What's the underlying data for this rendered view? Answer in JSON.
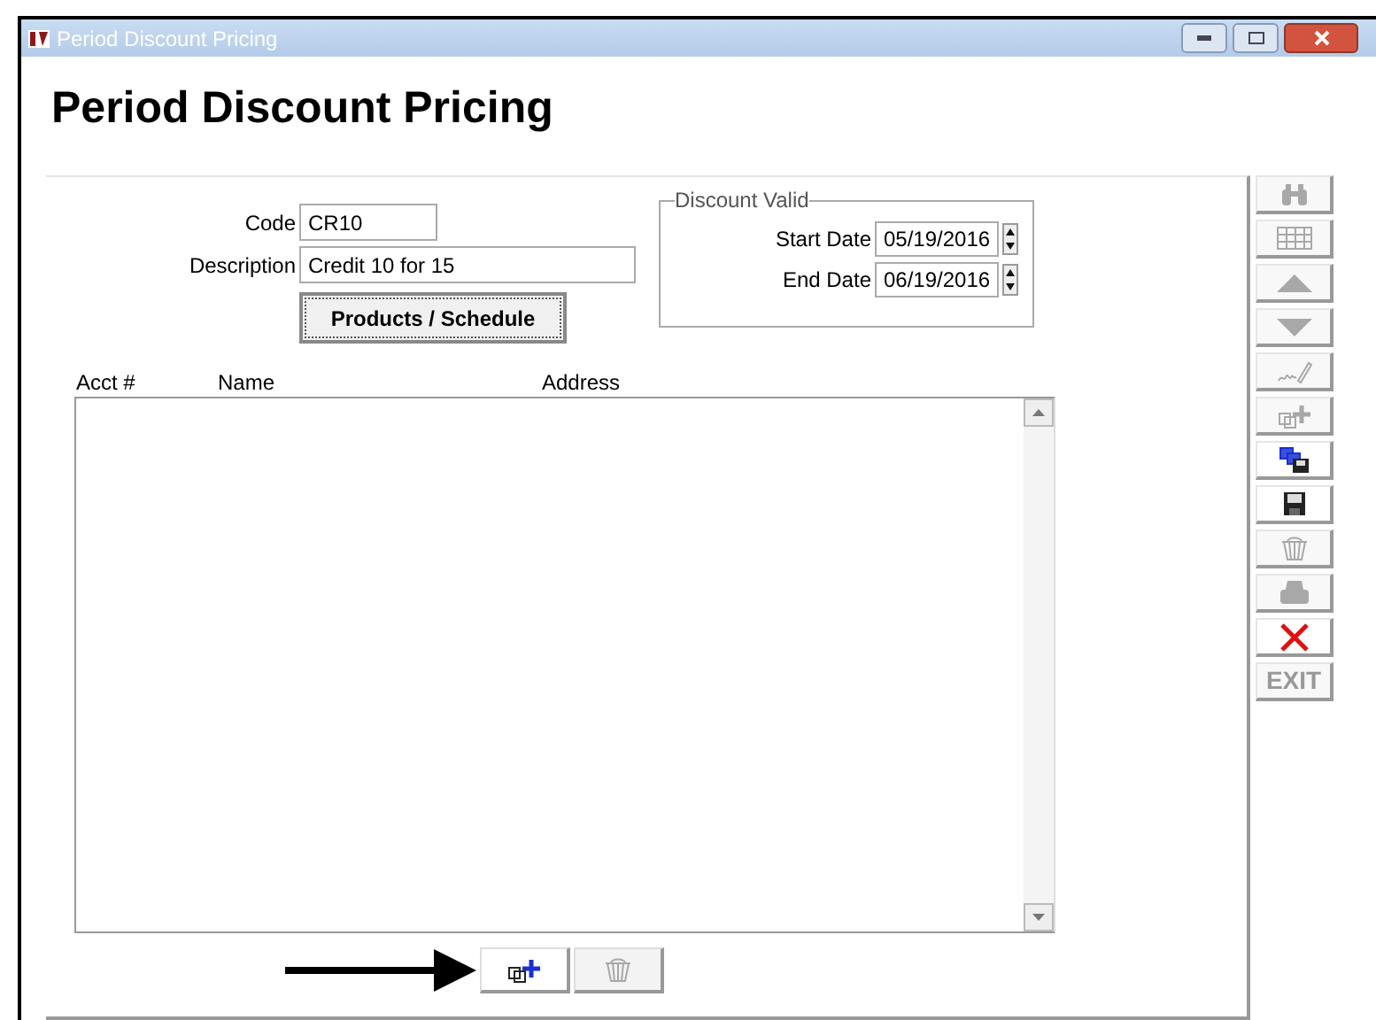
{
  "window": {
    "title": "Period Discount Pricing"
  },
  "heading": "Period Discount Pricing",
  "form": {
    "code": {
      "label": "Code",
      "value": "CR10"
    },
    "description": {
      "label": "Description",
      "value": "Credit 10 for 15"
    },
    "products_button": "Products / Schedule"
  },
  "discount_valid": {
    "title": "Discount Valid",
    "start": {
      "label": "Start Date",
      "value": "05/19/2016"
    },
    "end": {
      "label": "End Date",
      "value": "06/19/2016"
    }
  },
  "list": {
    "columns": [
      "Acct #",
      "Name",
      "Address"
    ]
  },
  "bottom_buttons": [
    {
      "kind": "add",
      "disabled": false
    },
    {
      "kind": "delete",
      "disabled": true
    }
  ],
  "toolbar": [
    {
      "kind": "find",
      "disabled": true
    },
    {
      "kind": "grid",
      "disabled": true
    },
    {
      "kind": "up",
      "disabled": true
    },
    {
      "kind": "down",
      "disabled": true
    },
    {
      "kind": "sign",
      "disabled": true
    },
    {
      "kind": "add",
      "disabled": true
    },
    {
      "kind": "copy",
      "disabled": false
    },
    {
      "kind": "save",
      "disabled": false
    },
    {
      "kind": "delete",
      "disabled": true
    },
    {
      "kind": "print",
      "disabled": true
    },
    {
      "kind": "cancel",
      "disabled": false
    },
    {
      "kind": "exit",
      "disabled": true,
      "label": "EXIT"
    }
  ]
}
